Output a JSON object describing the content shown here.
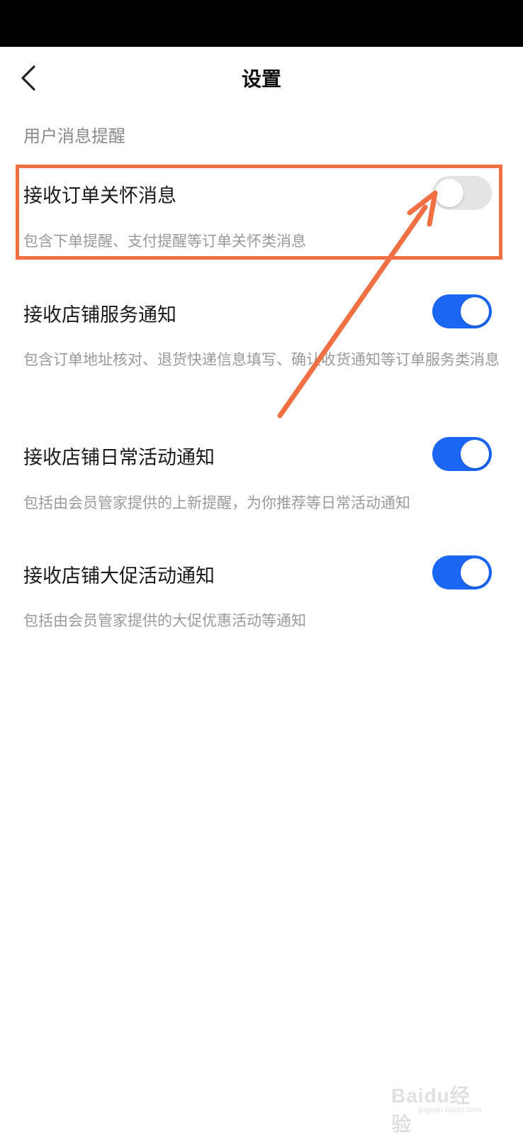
{
  "header": {
    "title": "设置",
    "back_icon": "chevron-left-icon"
  },
  "section": {
    "title": "用户消息提醒"
  },
  "settings": [
    {
      "label": "接收订单关怀消息",
      "description": "包含下单提醒、支付提醒等订单关怀类消息",
      "enabled": false
    },
    {
      "label": "接收店铺服务通知",
      "description": "包含订单地址核对、退货快递信息填写、确认收货通知等订单服务类消息",
      "enabled": true
    },
    {
      "label": "接收店铺日常活动通知",
      "description": "包括由会员管家提供的上新提醒，为你推荐等日常活动通知",
      "enabled": true
    },
    {
      "label": "接收店铺大促活动通知",
      "description": "包括由会员管家提供的大促优惠活动等通知",
      "enabled": true
    }
  ],
  "annotation": {
    "highlight_color": "#f07043"
  },
  "colors": {
    "toggle_on": "#1b66f2",
    "toggle_off": "#e4e4e4"
  },
  "watermark": {
    "brand": "Baidu经验",
    "url": "jingyan.baidu.com"
  }
}
